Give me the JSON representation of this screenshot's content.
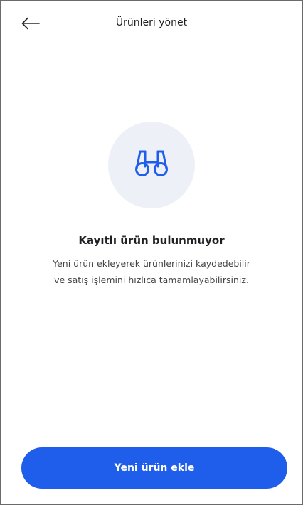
{
  "header": {
    "title": "Ürünleri yönet",
    "back_icon": "arrow-left-icon"
  },
  "empty_state": {
    "icon": "binoculars-icon",
    "title": "Kayıtlı ürün bulunmuyor",
    "description": "Yeni ürün ekleyerek ürünlerinizi kaydedebilir ve satış işlemini hızlıca tamamlayabilirsiniz."
  },
  "actions": {
    "add_button_label": "Yeni ürün ekle"
  },
  "colors": {
    "accent": "#1f5eea",
    "icon_circle": "#eef0f8",
    "text": "#1f1f23"
  }
}
